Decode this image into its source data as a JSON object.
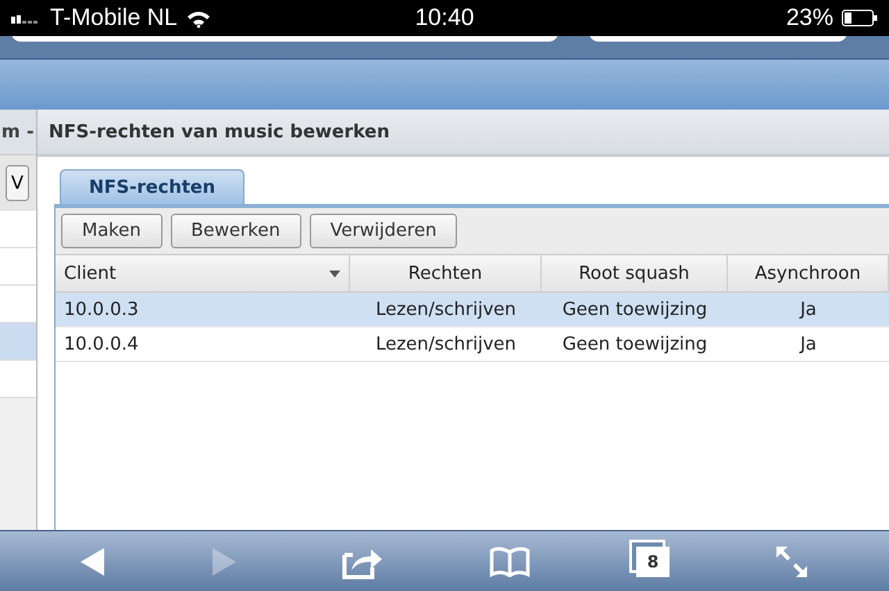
{
  "status_bar": {
    "carrier": "T-Mobile NL",
    "time": "10:40",
    "battery": "23%"
  },
  "background_window": {
    "title": "m -",
    "button": "V",
    "rows": [
      {
        "selected": false
      },
      {
        "selected": false
      },
      {
        "selected": false
      },
      {
        "selected": true
      },
      {
        "selected": false
      }
    ]
  },
  "dialog": {
    "title": "NFS-rechten van music bewerken",
    "tabs": [
      {
        "label": "NFS-rechten",
        "selected": true
      }
    ],
    "buttons": [
      "Maken",
      "Bewerken",
      "Verwijderen"
    ],
    "table": {
      "columns": [
        {
          "label": "Client",
          "menu": true
        },
        {
          "label": "Rechten",
          "menu": false
        },
        {
          "label": "Root squash",
          "menu": false
        },
        {
          "label": "Asynchroon",
          "menu": false
        }
      ],
      "rows": [
        {
          "cells": [
            "10.0.0.3",
            "Lezen/schrijven",
            "Geen toewijzing",
            "Ja"
          ],
          "selected": true
        },
        {
          "cells": [
            "10.0.0.4",
            "Lezen/schrijven",
            "Geen toewijzing",
            "Ja"
          ],
          "selected": false
        }
      ]
    }
  },
  "browser_toolbar": {
    "back_disabled": false,
    "forward_disabled": true,
    "tab_count": "8"
  }
}
